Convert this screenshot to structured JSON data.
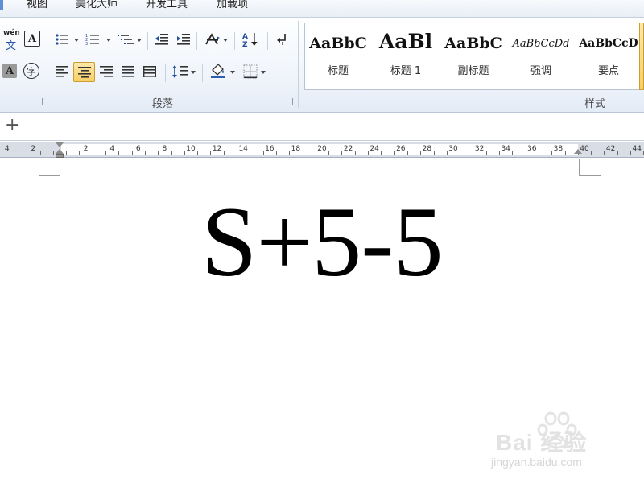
{
  "tabs": [
    "视图",
    "美化大师",
    "开发工具",
    "加载项"
  ],
  "ribbon": {
    "paragraph_group_label": "段落",
    "styles_group_label": "样式",
    "phonetic_guide_top": "wén",
    "phonetic_guide_bottom": "文",
    "char_border_letter": "A",
    "char_shading_letter": "A",
    "enclose_char": "字",
    "styles": [
      {
        "sample": "AaBbC",
        "name": "标题"
      },
      {
        "sample": "AaBl",
        "name": "标题 1"
      },
      {
        "sample": "AaBbC",
        "name": "副标题"
      },
      {
        "sample": "AaBbCcDd",
        "name": "强调"
      },
      {
        "sample": "AaBbCcD",
        "name": "要点"
      }
    ]
  },
  "quickbar": {
    "add_symbol": "+"
  },
  "ruler": {
    "labels": [
      "4",
      "2",
      "2",
      "4",
      "6",
      "8",
      "10",
      "12",
      "14",
      "16",
      "18",
      "20",
      "22",
      "24",
      "26",
      "28",
      "30",
      "32",
      "34",
      "36",
      "38",
      "40",
      "42",
      "44"
    ]
  },
  "document": {
    "text": "S+5-5"
  },
  "watermark": {
    "brand": "Bai 经验",
    "url": "jingyan.baidu.com"
  },
  "colors": {
    "accent": "#f8cf63",
    "ribbon": "#eef3fa"
  }
}
